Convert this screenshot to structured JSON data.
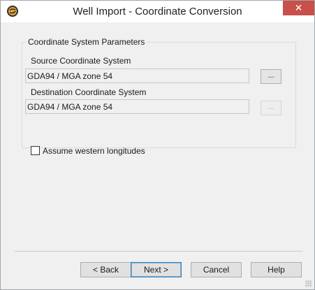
{
  "window": {
    "title": "Well Import - Coordinate Conversion",
    "close_label": "✕"
  },
  "group": {
    "title": "Coordinate System Parameters",
    "source_label": "Source Coordinate System",
    "source_value": "GDA94 / MGA zone 54",
    "destination_label": "Destination Coordinate System",
    "destination_value": "GDA94 / MGA zone 54",
    "browse_label": "...",
    "assume_western_label": "Assume western longitudes",
    "assume_western_checked": false
  },
  "buttons": {
    "back": "< Back",
    "next": "Next >",
    "cancel": "Cancel",
    "help": "Help"
  },
  "colors": {
    "close_button": "#c7504a",
    "default_button_border": "#3c7fb1"
  },
  "icons": {
    "app": "app-logo-icon",
    "resize": "resize-grip-icon"
  }
}
